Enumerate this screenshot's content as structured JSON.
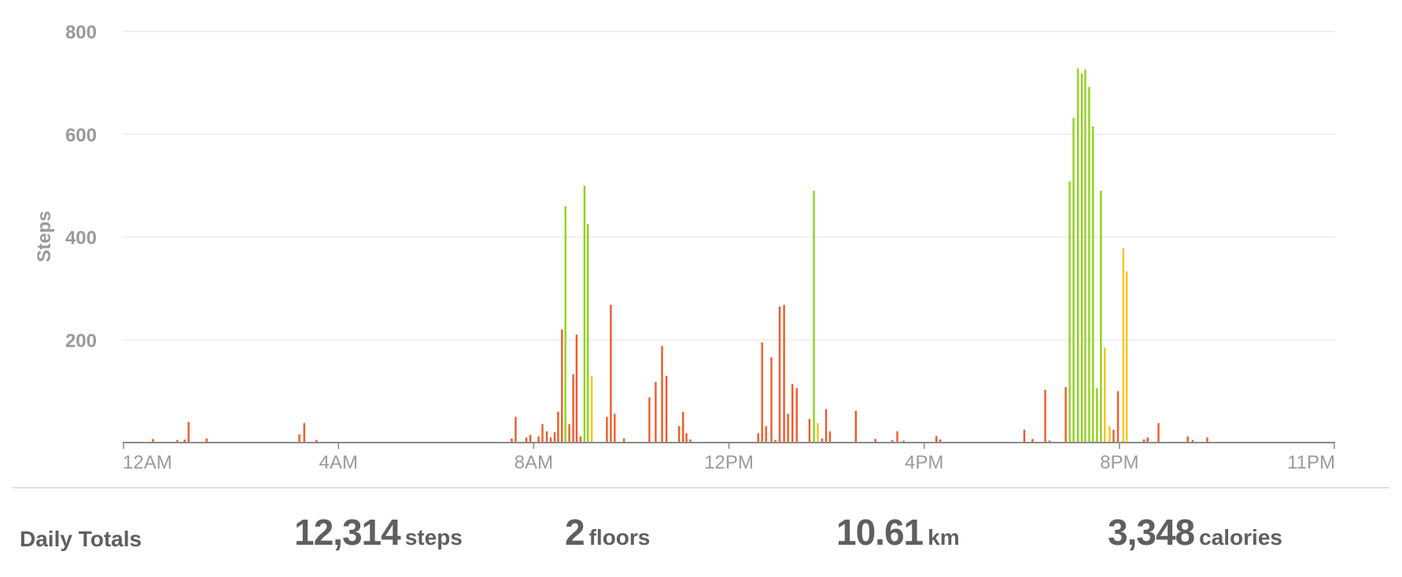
{
  "chart_data": {
    "type": "bar",
    "ylabel": "Steps",
    "ylim": [
      0,
      800
    ],
    "yticks": [
      "800",
      "600",
      "400",
      "200"
    ],
    "xticks": [
      "12AM",
      "4AM",
      "8AM",
      "12PM",
      "4PM",
      "8PM",
      "11PM"
    ],
    "x_unit": "hour of day",
    "xlim": [
      0,
      24
    ],
    "grid": true,
    "colors": {
      "low": "#f05a28",
      "medium": "#f5c518",
      "high": "#8fd31b",
      "axis": "#8a8a8a",
      "grid": "#ececec"
    },
    "bars": [
      {
        "x": 0.2,
        "steps": 7,
        "level": "low"
      },
      {
        "x": 0.7,
        "steps": 5,
        "level": "low"
      },
      {
        "x": 0.85,
        "steps": 6,
        "level": "low"
      },
      {
        "x": 0.93,
        "steps": 40,
        "level": "low"
      },
      {
        "x": 1.3,
        "steps": 8,
        "level": "low"
      },
      {
        "x": 3.2,
        "steps": 16,
        "level": "low"
      },
      {
        "x": 3.3,
        "steps": 38,
        "level": "low"
      },
      {
        "x": 3.55,
        "steps": 5,
        "level": "low"
      },
      {
        "x": 7.55,
        "steps": 8,
        "level": "low"
      },
      {
        "x": 7.63,
        "steps": 50,
        "level": "low"
      },
      {
        "x": 7.85,
        "steps": 10,
        "level": "low"
      },
      {
        "x": 7.93,
        "steps": 15,
        "level": "low"
      },
      {
        "x": 8.1,
        "steps": 12,
        "level": "low"
      },
      {
        "x": 8.18,
        "steps": 36,
        "level": "low"
      },
      {
        "x": 8.27,
        "steps": 22,
        "level": "low"
      },
      {
        "x": 8.35,
        "steps": 10,
        "level": "low"
      },
      {
        "x": 8.43,
        "steps": 20,
        "level": "low"
      },
      {
        "x": 8.5,
        "steps": 60,
        "level": "low"
      },
      {
        "x": 8.58,
        "steps": 220,
        "level": "low"
      },
      {
        "x": 8.65,
        "steps": 460,
        "level": "high"
      },
      {
        "x": 8.73,
        "steps": 36,
        "level": "low"
      },
      {
        "x": 8.81,
        "steps": 133,
        "level": "low"
      },
      {
        "x": 8.88,
        "steps": 210,
        "level": "low"
      },
      {
        "x": 8.96,
        "steps": 12,
        "level": "low"
      },
      {
        "x": 9.04,
        "steps": 500,
        "level": "high"
      },
      {
        "x": 9.11,
        "steps": 425,
        "level": "high"
      },
      {
        "x": 9.19,
        "steps": 130,
        "level": "medium"
      },
      {
        "x": 9.5,
        "steps": 50,
        "level": "low"
      },
      {
        "x": 9.58,
        "steps": 268,
        "level": "low"
      },
      {
        "x": 9.66,
        "steps": 56,
        "level": "low"
      },
      {
        "x": 9.85,
        "steps": 8,
        "level": "low"
      },
      {
        "x": 10.37,
        "steps": 88,
        "level": "low"
      },
      {
        "x": 10.5,
        "steps": 118,
        "level": "low"
      },
      {
        "x": 10.63,
        "steps": 188,
        "level": "low"
      },
      {
        "x": 10.72,
        "steps": 130,
        "level": "low"
      },
      {
        "x": 10.98,
        "steps": 32,
        "level": "low"
      },
      {
        "x": 11.06,
        "steps": 60,
        "level": "low"
      },
      {
        "x": 11.13,
        "steps": 18,
        "level": "low"
      },
      {
        "x": 11.21,
        "steps": 6,
        "level": "low"
      },
      {
        "x": 12.6,
        "steps": 18,
        "level": "low"
      },
      {
        "x": 12.68,
        "steps": 195,
        "level": "low"
      },
      {
        "x": 12.76,
        "steps": 32,
        "level": "low"
      },
      {
        "x": 12.87,
        "steps": 166,
        "level": "low"
      },
      {
        "x": 12.95,
        "steps": 5,
        "level": "low"
      },
      {
        "x": 13.04,
        "steps": 265,
        "level": "low"
      },
      {
        "x": 13.13,
        "steps": 268,
        "level": "low"
      },
      {
        "x": 13.21,
        "steps": 56,
        "level": "low"
      },
      {
        "x": 13.3,
        "steps": 114,
        "level": "low"
      },
      {
        "x": 13.39,
        "steps": 106,
        "level": "low"
      },
      {
        "x": 13.65,
        "steps": 46,
        "level": "low"
      },
      {
        "x": 13.74,
        "steps": 490,
        "level": "high"
      },
      {
        "x": 13.82,
        "steps": 38,
        "level": "medium"
      },
      {
        "x": 13.91,
        "steps": 8,
        "level": "low"
      },
      {
        "x": 13.99,
        "steps": 65,
        "level": "low"
      },
      {
        "x": 14.07,
        "steps": 22,
        "level": "low"
      },
      {
        "x": 14.6,
        "steps": 62,
        "level": "low"
      },
      {
        "x": 15.0,
        "steps": 7,
        "level": "low"
      },
      {
        "x": 15.35,
        "steps": 5,
        "level": "low"
      },
      {
        "x": 15.45,
        "steps": 22,
        "level": "low"
      },
      {
        "x": 15.58,
        "steps": 4,
        "level": "low"
      },
      {
        "x": 16.25,
        "steps": 13,
        "level": "low"
      },
      {
        "x": 16.33,
        "steps": 6,
        "level": "low"
      },
      {
        "x": 18.05,
        "steps": 25,
        "level": "low"
      },
      {
        "x": 18.22,
        "steps": 7,
        "level": "low"
      },
      {
        "x": 18.48,
        "steps": 103,
        "level": "low"
      },
      {
        "x": 18.57,
        "steps": 4,
        "level": "low"
      },
      {
        "x": 18.9,
        "steps": 108,
        "level": "low"
      },
      {
        "x": 18.98,
        "steps": 508,
        "level": "high"
      },
      {
        "x": 19.06,
        "steps": 632,
        "level": "high"
      },
      {
        "x": 19.15,
        "steps": 728,
        "level": "high"
      },
      {
        "x": 19.23,
        "steps": 718,
        "level": "high"
      },
      {
        "x": 19.3,
        "steps": 726,
        "level": "high"
      },
      {
        "x": 19.38,
        "steps": 692,
        "level": "high"
      },
      {
        "x": 19.46,
        "steps": 615,
        "level": "high"
      },
      {
        "x": 19.54,
        "steps": 106,
        "level": "high"
      },
      {
        "x": 19.62,
        "steps": 490,
        "level": "high"
      },
      {
        "x": 19.7,
        "steps": 185,
        "level": "medium"
      },
      {
        "x": 19.8,
        "steps": 32,
        "level": "medium"
      },
      {
        "x": 19.88,
        "steps": 25,
        "level": "low"
      },
      {
        "x": 19.97,
        "steps": 100,
        "level": "low"
      },
      {
        "x": 20.08,
        "steps": 378,
        "level": "medium"
      },
      {
        "x": 20.15,
        "steps": 333,
        "level": "medium"
      },
      {
        "x": 20.5,
        "steps": 6,
        "level": "low"
      },
      {
        "x": 20.58,
        "steps": 10,
        "level": "low"
      },
      {
        "x": 20.8,
        "steps": 38,
        "level": "low"
      },
      {
        "x": 21.4,
        "steps": 12,
        "level": "low"
      },
      {
        "x": 21.5,
        "steps": 5,
        "level": "low"
      },
      {
        "x": 21.8,
        "steps": 10,
        "level": "low"
      }
    ]
  },
  "totals": {
    "label": "Daily Totals",
    "steps": {
      "value": "12,314",
      "unit": "steps"
    },
    "floors": {
      "value": "2",
      "unit": "floors"
    },
    "distance": {
      "value": "10.61",
      "unit": "km"
    },
    "calories": {
      "value": "3,348",
      "unit": "calories"
    }
  }
}
